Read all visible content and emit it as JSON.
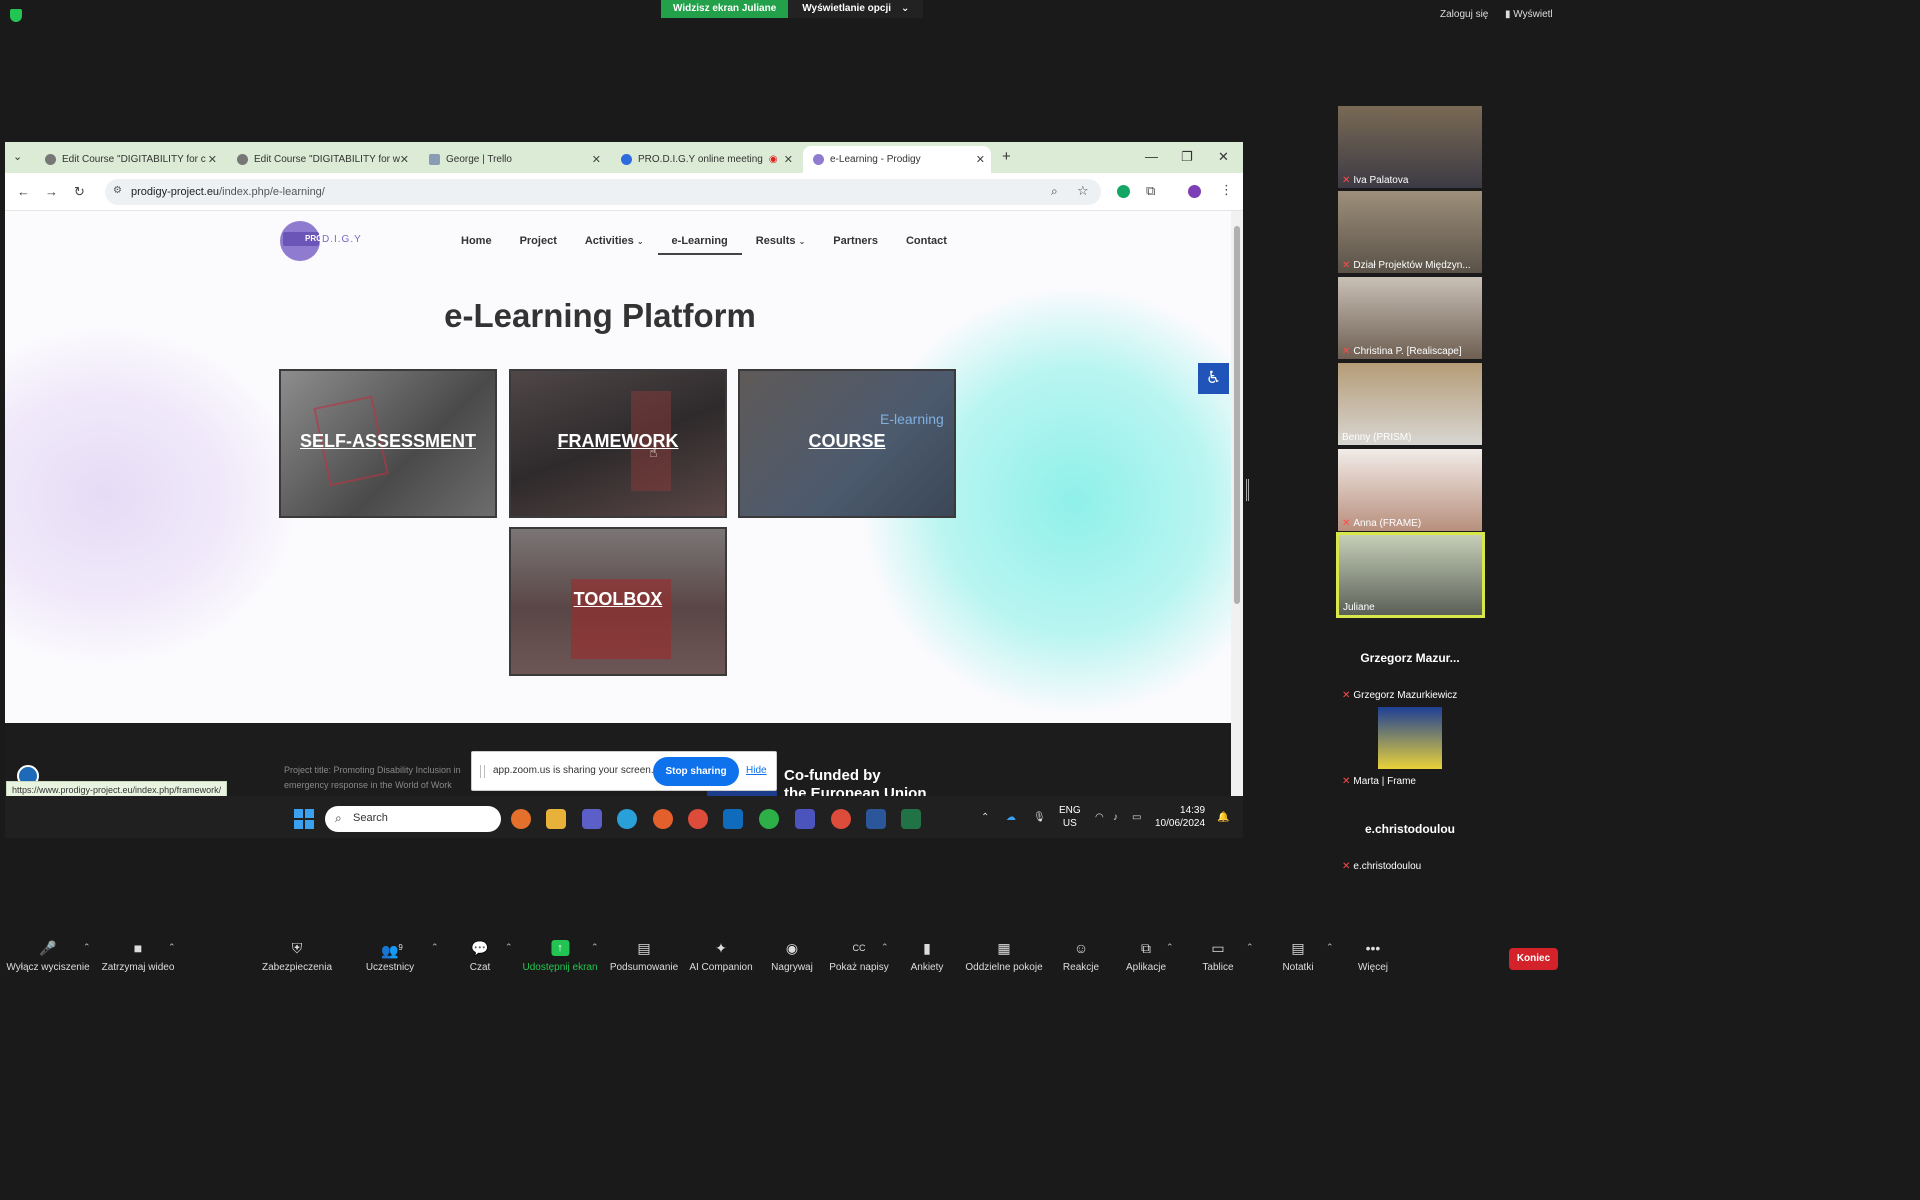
{
  "zoom_top": {
    "share_banner": "Widzisz ekran Juliane",
    "view_options": "Wyświetlanie opcji",
    "login": "Zaloguj się",
    "view": "Wyświetl"
  },
  "browser": {
    "tabs": [
      {
        "label": "Edit Course \"DIGITABILITY for c",
        "icon": "globe-icon"
      },
      {
        "label": "Edit Course \"DIGITABILITY for w",
        "icon": "globe-icon"
      },
      {
        "label": "George | Trello",
        "icon": "trello-icon"
      },
      {
        "label": "PRO.D.I.G.Y online meeting",
        "icon": "zoom-icon"
      },
      {
        "label": "e-Learning - Prodigy",
        "icon": "prodigy-icon"
      }
    ],
    "url_domain": "prodigy-project.eu",
    "url_path": "/index.php/e-learning/",
    "status_url": "https://www.prodigy-project.eu/index.php/framework/"
  },
  "site": {
    "logo_pro": "PRO",
    "logo_digy": "D.I.G.Y",
    "menu": [
      "Home",
      "Project",
      "Activities",
      "e-Learning",
      "Results",
      "Partners",
      "Contact"
    ],
    "title": "e-Learning Platform",
    "cards": [
      "SELF-ASSESSMENT",
      "FRAMEWORK",
      "COURSE",
      "TOOLBOX"
    ],
    "course_overlay_text": "E-learning",
    "footer_project": "Project title: Promoting Disability Inclusion in emergency response in the World of Work",
    "cofunded_line1": "Co-funded by",
    "cofunded_line2": "the European Union"
  },
  "sharing_bar": {
    "text": "app.zoom.us is sharing your screen.",
    "stop": "Stop sharing",
    "hide": "Hide"
  },
  "taskbar": {
    "search": "Search",
    "lang1": "ENG",
    "lang2": "US",
    "time": "14:39",
    "date": "10/06/2024"
  },
  "participants": [
    {
      "name": "Iva Palatova",
      "muted": true
    },
    {
      "name": "Dział Projektów Międzyn...",
      "muted": true
    },
    {
      "name": "Christina P. [Realiscape]",
      "muted": true
    },
    {
      "name": "Benny (PRISM)",
      "muted": false
    },
    {
      "name": "Anna (FRAME)",
      "muted": true
    },
    {
      "name": "Juliane",
      "muted": false
    },
    {
      "big": "Grzegorz  Mazur...",
      "name": "Grzegorz Mazurkiewicz",
      "muted": true
    },
    {
      "name": "Marta | Frame",
      "muted": true
    },
    {
      "big": "e.christodoulou",
      "name": "e.christodoulou",
      "muted": true
    }
  ],
  "toolbar": {
    "mute": "Wyłącz wyciszenie",
    "video": "Zatrzymaj wideo",
    "security": "Zabezpieczenia",
    "participants": "Uczestnicy",
    "participants_count": "9",
    "chat": "Czat",
    "share": "Udostępnij ekran",
    "summary": "Podsumowanie",
    "ai": "AI Companion",
    "record": "Nagrywaj",
    "captions": "Pokaż napisy",
    "polls": "Ankiety",
    "breakout": "Oddzielne pokoje",
    "reactions": "Reakcje",
    "apps": "Aplikacje",
    "whiteboards": "Tablice",
    "notes": "Notatki",
    "more": "Więcej",
    "end": "Koniec"
  },
  "colors": {
    "zoom_green": "#23a04a",
    "accent_blue": "#0e72ed",
    "end_red": "#d3222a",
    "prodigy_purple": "#8f7bd0"
  }
}
